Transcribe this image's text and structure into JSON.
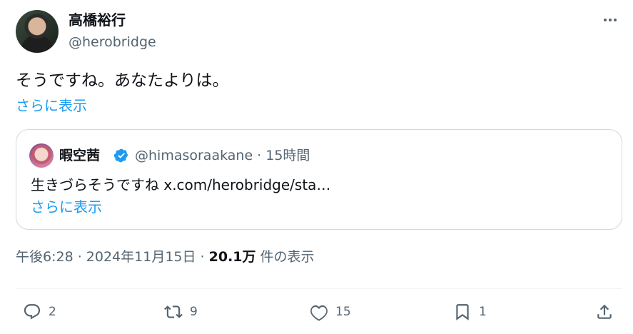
{
  "author": {
    "name": "高橋裕行",
    "handle": "@herobridge"
  },
  "tweet": {
    "text": "そうですね。あなたよりは。",
    "show_more": "さらに表示"
  },
  "quote": {
    "name": "暇空茜",
    "handle_time": "@himasoraakane · 15時間",
    "text": "生きづらそうですね x.com/herobridge/sta…",
    "show_more": "さらに表示"
  },
  "meta": {
    "time_date": "午後6:28 · 2024年11月15日 · ",
    "views": "20.1万",
    "views_suffix": " 件の表示"
  },
  "actions": {
    "replies": "2",
    "retweets": "9",
    "likes": "15",
    "bookmarks": "1"
  },
  "colors": {
    "accent": "#1d9bf0",
    "text": "#0f1419",
    "muted": "#536471",
    "border": "#cfd9de"
  },
  "icons": [
    "more-icon",
    "verified-badge-icon",
    "reply-icon",
    "retweet-icon",
    "like-icon",
    "bookmark-icon",
    "share-icon"
  ]
}
